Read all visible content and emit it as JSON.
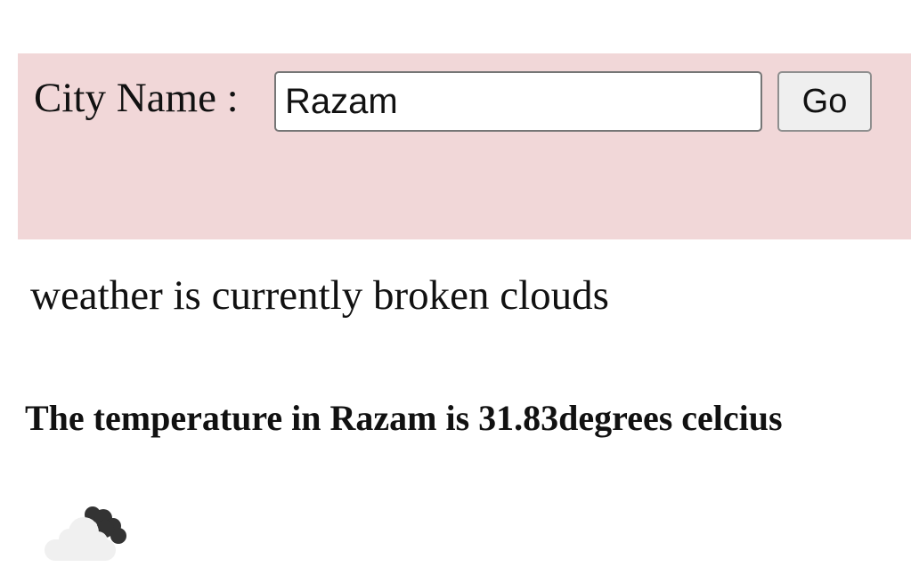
{
  "search": {
    "label": "City Name :",
    "value": "Razam",
    "button_label": "Go"
  },
  "weather": {
    "description": "weather is currently broken clouds",
    "temperature_text": "The temperature in Razam is 31.83degrees celcius",
    "icon": "broken-clouds-icon"
  },
  "colors": {
    "panel_background": "#f1d7d8",
    "front_cloud": "#f0f0f0",
    "back_cloud": "#333333"
  }
}
